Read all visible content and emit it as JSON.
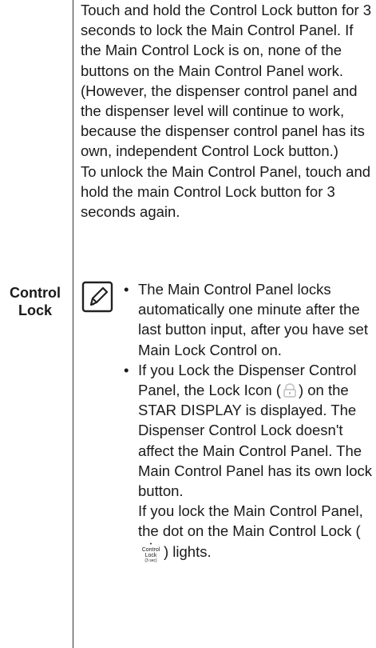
{
  "term": {
    "line1": "Control",
    "line2": "Lock"
  },
  "description": {
    "para1": "Touch and hold the Control Lock button for 3 seconds to lock the Main Control Panel. If the Main Control Lock is on, none of the buttons on the Main Control Panel work.",
    "para2": "(However, the dispenser control panel and the dispenser level will continue to work, because the dispenser control panel has its own, independent Control Lock button.)",
    "para3": "To unlock the Main Control Panel, touch and hold the main Control Lock button for 3 seconds again."
  },
  "note": {
    "icon": "note-pencil-icon",
    "bullet1": "The Main Control Panel locks automatically one minute after the last button input, after you have set Main Lock Control on.",
    "bullet2_before": "If you Lock the Dispenser Control Panel, the Lock Icon (",
    "bullet2_after": ") on the STAR DISPLAY is displayed. The Dispenser Control Lock doesn't affect the Main Control Panel. The Main Control Panel has its own lock button.",
    "bullet2_cont_before": "If you lock the Main Control Panel, the dot on the Main Control Lock (",
    "bullet2_cont_after": ") lights.",
    "cl_icon": {
      "line1": "Control",
      "line2": "Lock",
      "line3": "(3 sec)"
    }
  }
}
